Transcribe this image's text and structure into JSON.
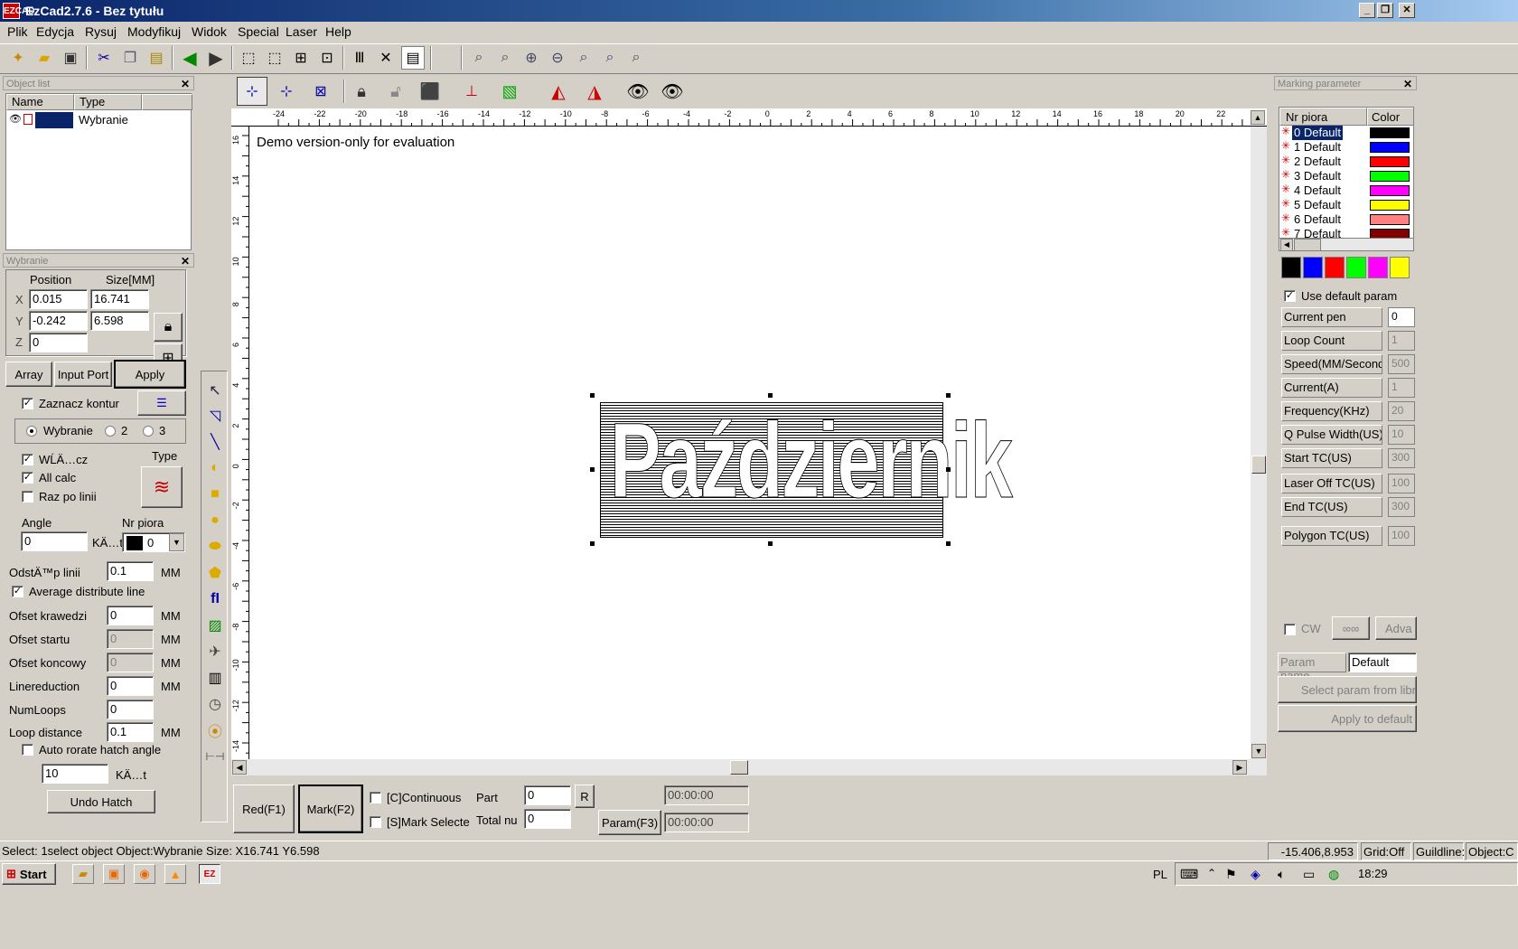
{
  "window": {
    "title": "EzCad2.7.6 - Bez tytułu",
    "app_icon": "EZCAD",
    "min": "_",
    "max": "❐",
    "close": "✕"
  },
  "menu": [
    "Plik",
    "Edycja",
    "Rysuj",
    "Modyfikuj",
    "Widok",
    "Special",
    "Laser",
    "Help"
  ],
  "object_list": {
    "title": "Object list",
    "col_name": "Name",
    "col_type": "Type",
    "rows": [
      {
        "name": "",
        "type": "Wybranie"
      }
    ]
  },
  "properties": {
    "title": "Wybranie",
    "position_label": "Position",
    "size_label": "Size[MM]",
    "x_label": "X",
    "y_label": "Y",
    "z_label": "Z",
    "x_pos": "0.015",
    "x_size": "16.741",
    "y_pos": "-0.242",
    "y_size": "6.598",
    "z_pos": "0",
    "array_btn": "Array",
    "input_port_btn": "Input Port",
    "apply_btn": "Apply",
    "zaznacz_kontur": "Zaznacz kontur",
    "radio_1": "Wybranie",
    "radio_2": "2",
    "radio_3": "3",
    "wlacz": "WĹÄ…cz",
    "all_calc": "All calc",
    "raz_po_linii": "Raz po linii",
    "type_label": "Type",
    "angle_label": "Angle",
    "angle_value": "0",
    "angle_unit": "KÄ…t",
    "nr_piora_label": "Nr piora",
    "nr_piora_value": "0",
    "odstep_label": "OdstÄ™p linii",
    "odstep_value": "0.1",
    "mm": "MM",
    "avg_line": "Average distribute line",
    "ofset_krawedzi": "Ofset krawedzi",
    "ofset_krawedzi_v": "0",
    "ofset_startu": "Ofset startu",
    "ofset_startu_v": "0",
    "ofset_koncowy": "Ofset koncowy",
    "ofset_koncowy_v": "0",
    "linereduction": "Linereduction",
    "linereduction_v": "0",
    "numloops": "NumLoops",
    "numloops_v": "0",
    "loop_distance": "Loop distance",
    "loop_distance_v": "0.1",
    "auto_rotate": "Auto rorate hatch angle",
    "rotate_value": "10",
    "rotate_unit": "KÄ…t",
    "undo_hatch": "Undo Hatch"
  },
  "canvas": {
    "demo_text": "Demo version-only for evaluation",
    "object_text": "Październik",
    "h_ruler": [
      "-24",
      "-22",
      "-20",
      "-18",
      "-16",
      "-14",
      "-12",
      "-10",
      "-8",
      "-6",
      "-4",
      "-2",
      "0",
      "2",
      "4",
      "6",
      "8",
      "10",
      "12",
      "14",
      "16",
      "18",
      "20",
      "22"
    ],
    "v_ruler": [
      "16",
      "14",
      "12",
      "10",
      "8",
      "6",
      "4",
      "2",
      "0",
      "-2",
      "-4",
      "-6",
      "-8",
      "-10",
      "-12",
      "-14"
    ]
  },
  "bottom": {
    "red_btn": "Red(F1)",
    "mark_btn": "Mark(F2)",
    "continuous": "[C]Continuous",
    "mark_selected": "[S]Mark Selecte",
    "part_label": "Part",
    "part_value": "0",
    "r_btn": "R",
    "total_label": "Total nu",
    "total_value": "0",
    "param_btn": "Param(F3)",
    "time1": "00:00:00",
    "time2": "00:00:00"
  },
  "marking": {
    "title": "Marking parameter",
    "col_pen": "Nr piora",
    "col_color": "Color",
    "pens": [
      {
        "name": "0 Default",
        "color": "#000000"
      },
      {
        "name": "1 Default",
        "color": "#0000ff"
      },
      {
        "name": "2 Default",
        "color": "#ff0000"
      },
      {
        "name": "3 Default",
        "color": "#00ff00"
      },
      {
        "name": "4 Default",
        "color": "#ff00ff"
      },
      {
        "name": "5 Default",
        "color": "#ffff00"
      },
      {
        "name": "6 Default",
        "color": "#ff8080"
      },
      {
        "name": "7 Default",
        "color": "#800000"
      }
    ],
    "swatches": [
      "#000000",
      "#0000ff",
      "#ff0000",
      "#00ff00",
      "#ff00ff",
      "#ffff00"
    ],
    "use_default": "Use default param",
    "params": [
      {
        "label": "Current pen",
        "value": "0"
      },
      {
        "label": "Loop Count",
        "value": "1"
      },
      {
        "label": "Speed(MM/Second",
        "value": "500"
      },
      {
        "label": "Current(A)",
        "value": "1"
      },
      {
        "label": "Frequency(KHz)",
        "value": "20"
      },
      {
        "label": "Q Pulse Width(US)",
        "value": "10"
      },
      {
        "label": "Start TC(US)",
        "value": "300"
      },
      {
        "label": "Laser Off TC(US)",
        "value": "100"
      },
      {
        "label": "End TC(US)",
        "value": "300"
      },
      {
        "label": "Polygon TC(US)",
        "value": "100"
      }
    ],
    "cw": "CW",
    "adv": "Adva",
    "param_name_label": "Param name",
    "param_name_value": "Default",
    "select_param": "Select param from libr",
    "apply_default": "Apply to default"
  },
  "status": {
    "text": "Select: 1select object Object:Wybranie Size: X16.741 Y6.598",
    "coords": "-15.406,8.953",
    "grid": "Grid:Off",
    "guide": "Guildline:",
    "object": "Object:C"
  },
  "taskbar": {
    "start": "Start",
    "lang": "PL",
    "time": "18:29"
  }
}
